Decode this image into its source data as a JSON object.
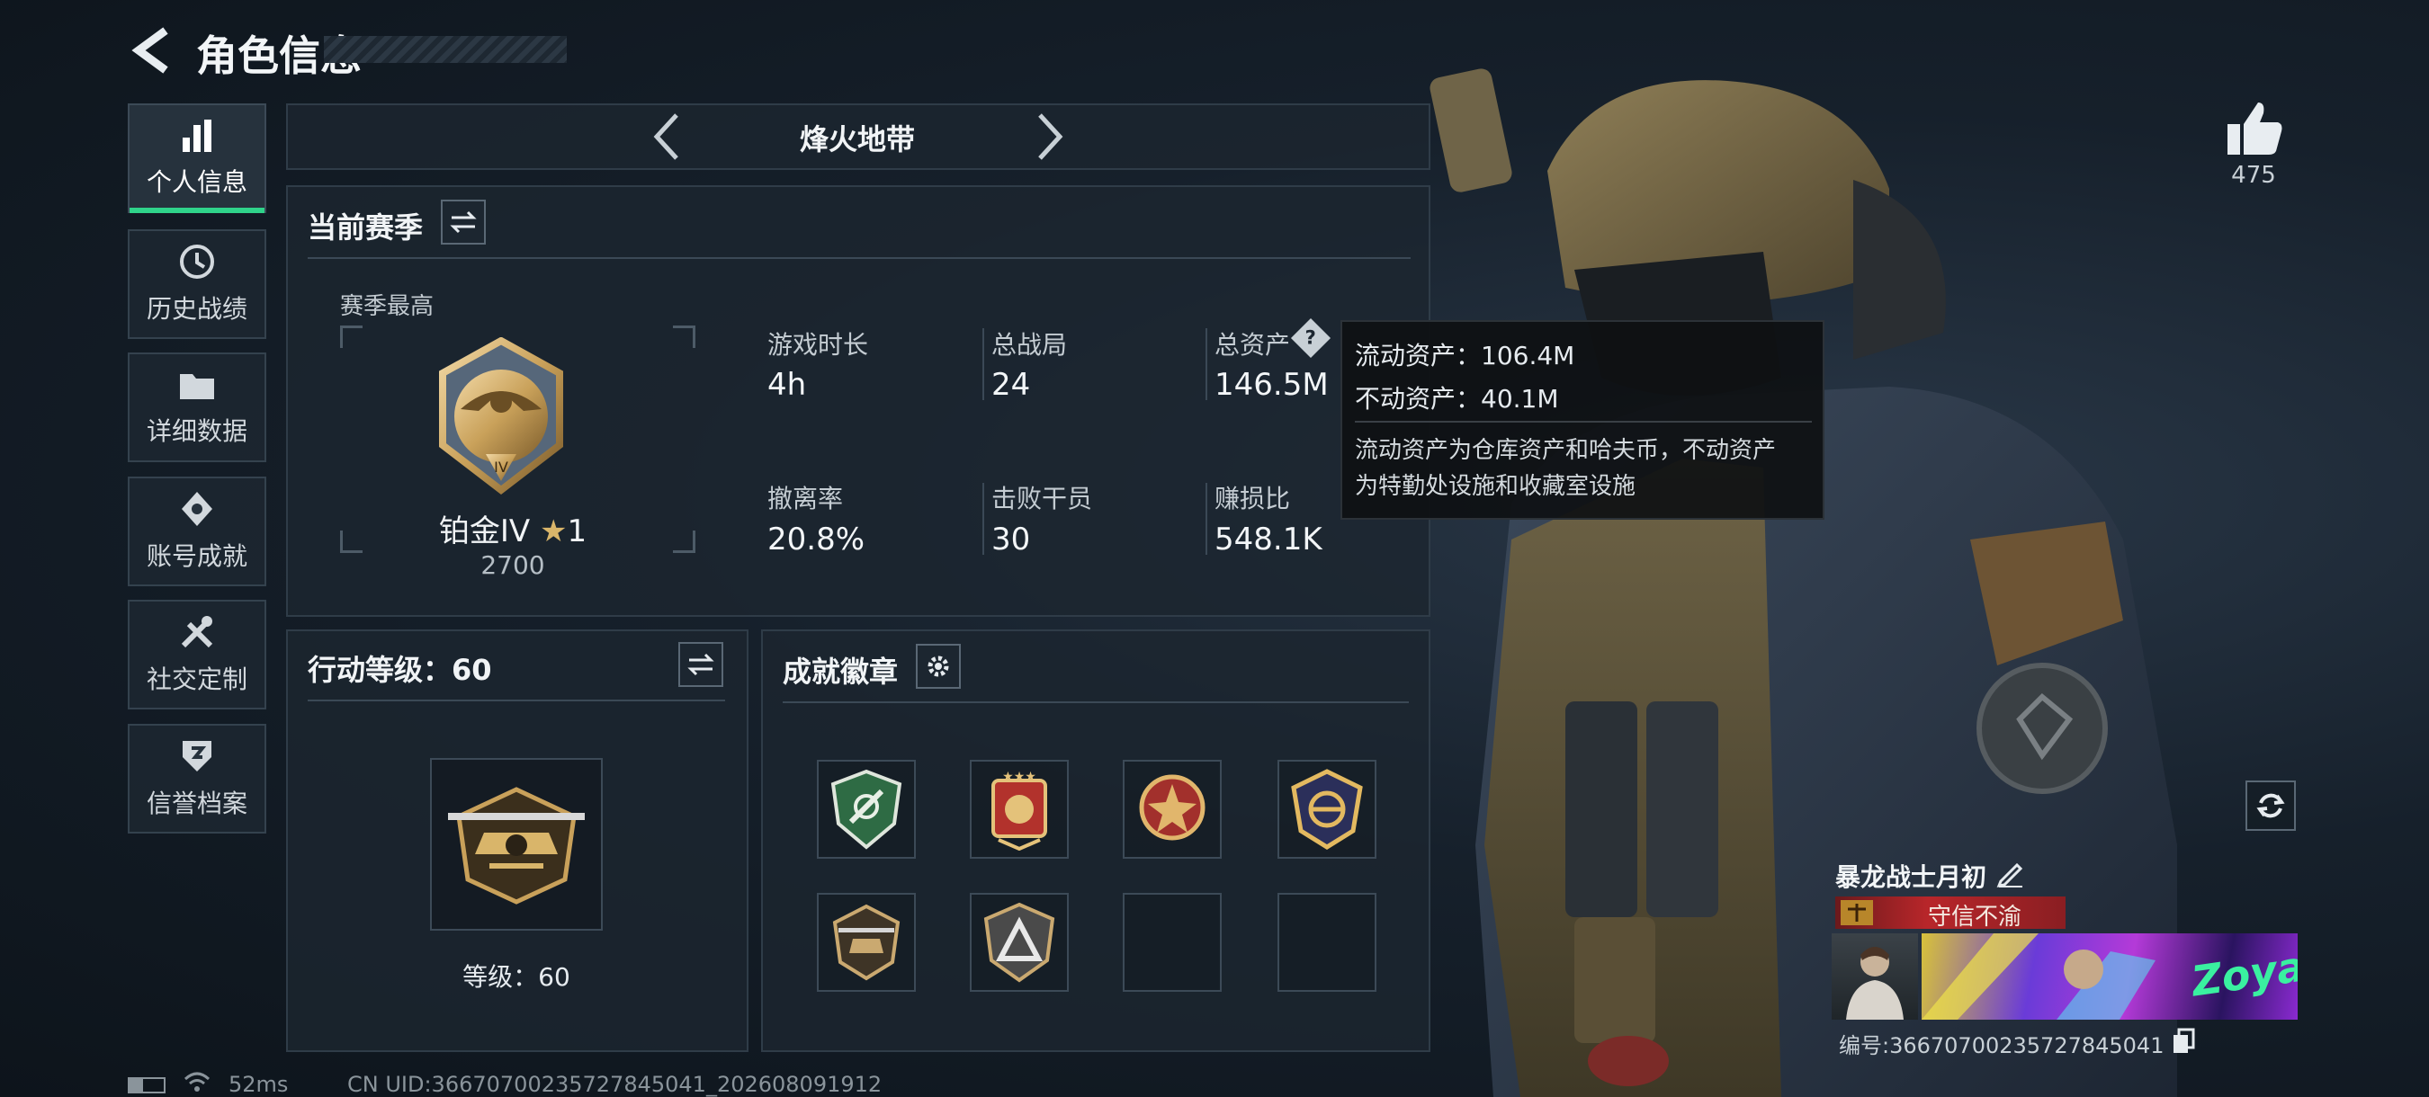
{
  "header": {
    "title": "角色信息"
  },
  "sidebar": {
    "items": [
      {
        "label": "个人信息",
        "icon": "bar-chart-icon",
        "active": true
      },
      {
        "label": "历史战绩",
        "icon": "history-icon"
      },
      {
        "label": "详细数据",
        "icon": "folder-icon"
      },
      {
        "label": "账号成就",
        "icon": "achievement-icon"
      },
      {
        "label": "社交定制",
        "icon": "tools-icon"
      },
      {
        "label": "信誉档案",
        "icon": "credit-icon"
      }
    ]
  },
  "mode_selector": {
    "label": "烽火地带"
  },
  "season": {
    "title": "当前赛季",
    "best_label": "赛季最高",
    "rank_name": "铂金IV",
    "rank_stars": "1",
    "rank_score": "2700",
    "stats": [
      {
        "label": "游戏时长",
        "value": "4h"
      },
      {
        "label": "总战局",
        "value": "24"
      },
      {
        "label": "总资产",
        "value": "146.5M"
      },
      {
        "label": "撤离率",
        "value": "20.8%"
      },
      {
        "label": "击败干员",
        "value": "30"
      },
      {
        "label": "赚损比",
        "value": "548.1K"
      }
    ]
  },
  "tooltip": {
    "liquid": "流动资产：106.4M",
    "fixed": "不动资产：40.1M",
    "desc_line1": "流动资产为仓库资产和哈夫币，不动资产",
    "desc_line2": "为特勤处设施和收藏室设施"
  },
  "action_level": {
    "title": "行动等级：60",
    "level_text": "等级：60"
  },
  "badges": {
    "title": "成就徽章",
    "slots": [
      {
        "icon": "green-shield-badge-icon"
      },
      {
        "icon": "gold-star-badge-icon"
      },
      {
        "icon": "red-emblem-badge-icon"
      },
      {
        "icon": "navy-emblem-badge-icon"
      },
      {
        "icon": "helicopter-badge-icon"
      },
      {
        "icon": "triangle-badge-icon"
      },
      {
        "icon": ""
      },
      {
        "icon": ""
      }
    ]
  },
  "likes": {
    "count": "475"
  },
  "profile": {
    "name": "暴龙战士月初",
    "tag": "守信不渝",
    "banner_text": "Zoya",
    "uid_line": "编号:36670700235727845041"
  },
  "status_bar": {
    "ping": "52ms",
    "uid": "CN UID:36670700235727845041_202608091912"
  },
  "colors": {
    "accent": "#2fd38a",
    "panel": "#1c2630",
    "tag_red": "#b8262a",
    "gold": "#c9a15a"
  }
}
